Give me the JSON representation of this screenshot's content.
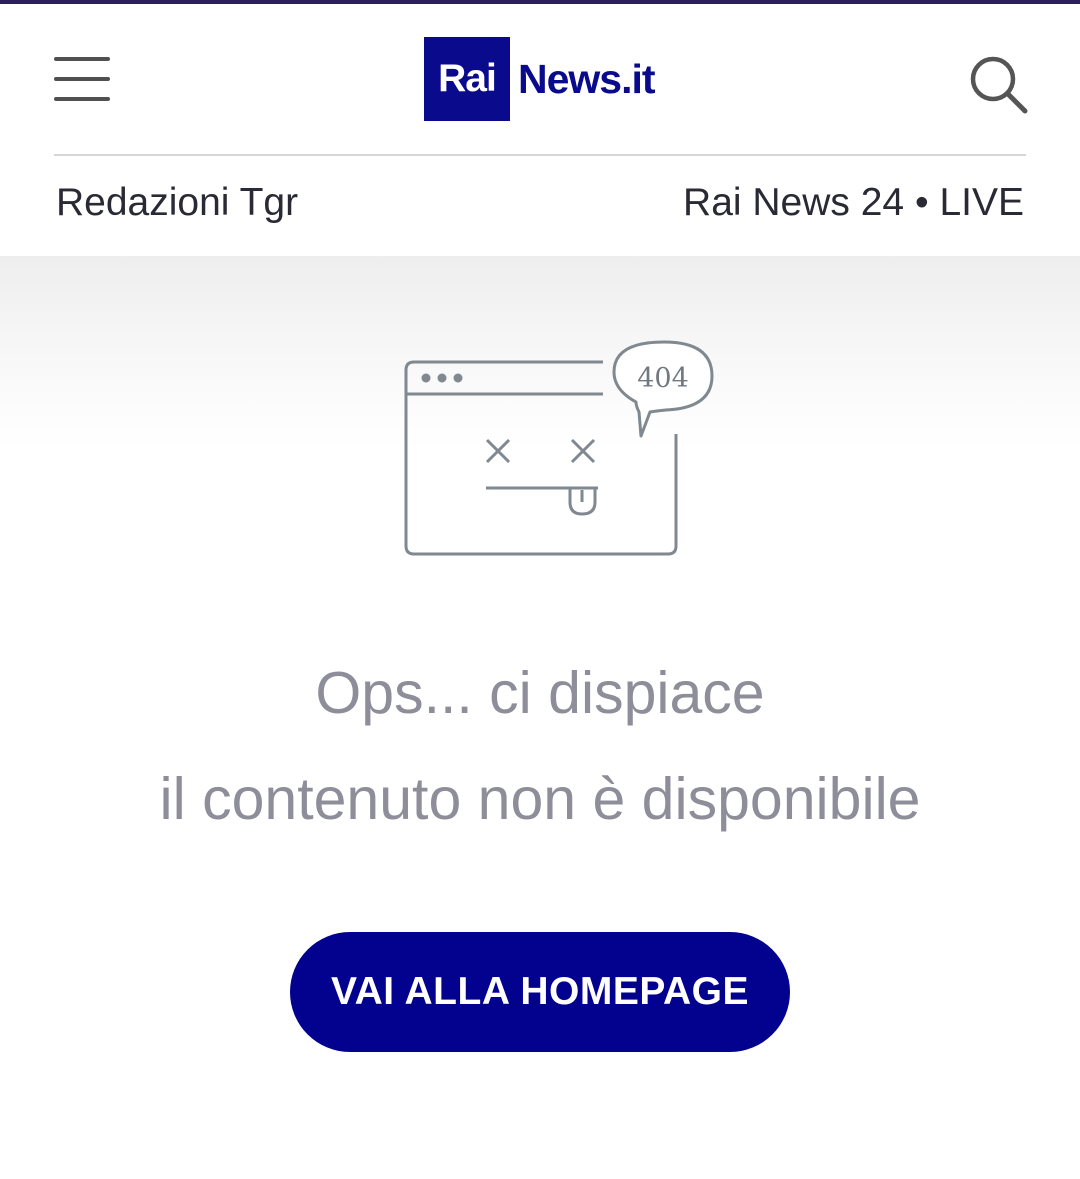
{
  "header": {
    "menu_icon": "hamburger-menu-icon",
    "logo": {
      "mark": "Rai",
      "text": "News.it"
    },
    "search_icon": "search-icon"
  },
  "nav": {
    "left": "Redazioni Tgr",
    "right": "Rai News 24 • LIVE"
  },
  "error": {
    "illustration_icon": "broken-browser-404-icon",
    "code": "404",
    "line1": "Ops... ci dispiace",
    "line2": "il contenuto non è disponibile"
  },
  "cta": {
    "label": "VAI ALLA HOMEPAGE"
  },
  "colors": {
    "brand": "#0a0a8c",
    "button": "#02028f",
    "message_text": "#8e8e9a",
    "nav_text": "#2a2a35"
  }
}
